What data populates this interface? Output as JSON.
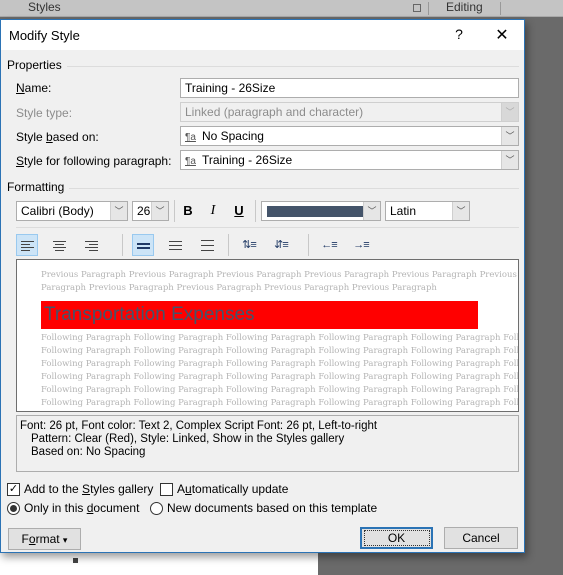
{
  "ribbon": {
    "styles_label": "Styles",
    "editing_label": "Editing"
  },
  "dialog": {
    "title": "Modify Style",
    "help_label": "?",
    "close_label": "✕"
  },
  "properties": {
    "group_label": "Properties",
    "name": {
      "label_prefix": "",
      "label_accel": "N",
      "label_rest": "ame:",
      "value": "Training - 26Size"
    },
    "style_type": {
      "label": "Style type:",
      "value": "Linked (paragraph and character)"
    },
    "based_on": {
      "label_pre": "Style ",
      "label_accel": "b",
      "label_rest": "ased on:",
      "value": "No Spacing",
      "icon": "¶a"
    },
    "following": {
      "label_accel": "S",
      "label_rest": "tyle for following paragraph:",
      "value": "Training - 26Size",
      "icon": "¶a"
    }
  },
  "formatting": {
    "group_label": "Formatting",
    "font": "Calibri (Body)",
    "size": "26",
    "bold": "B",
    "italic": "I",
    "underline": "U",
    "font_color": "#44546a",
    "script": "Latin",
    "alignment_selected": "left",
    "spacing_selected": "single"
  },
  "preview": {
    "previous_lines": [
      "Previous Paragraph Previous Paragraph Previous Paragraph Previous Paragraph Previous Paragraph Previous",
      "Paragraph Previous Paragraph Previous Paragraph Previous Paragraph Previous Paragraph"
    ],
    "sample_text": "Transportation Expenses",
    "sample_bg": "#ff0000",
    "sample_color": "#44546a",
    "following_lines": [
      "Following Paragraph Following Paragraph Following Paragraph Following Paragraph Following Paragraph Following Paragraph",
      "Following Paragraph Following Paragraph Following Paragraph Following Paragraph Following Paragraph Following Paragraph",
      "Following Paragraph Following Paragraph Following Paragraph Following Paragraph Following Paragraph Following Paragraph",
      "Following Paragraph Following Paragraph Following Paragraph Following Paragraph Following Paragraph Following Paragraph",
      "Following Paragraph Following Paragraph Following Paragraph Following Paragraph Following Paragraph Following Paragraph",
      "Following Paragraph Following Paragraph Following Paragraph Following Paragraph Following Paragraph Following Paragraph"
    ]
  },
  "description": {
    "line1": "Font: 26 pt, Font color: Text 2, Complex Script Font: 26 pt, Left-to-right",
    "line2": "Pattern: Clear (Red), Style: Linked, Show in the Styles gallery",
    "line3": "Based on: No Spacing"
  },
  "options": {
    "add_to_gallery": {
      "pre": "Add to the ",
      "accel": "S",
      "rest": "tyles gallery",
      "checked": true
    },
    "auto_update": {
      "pre": "A",
      "accel": "u",
      "rest": "tomatically update",
      "checked": false
    },
    "only_this_doc": {
      "pre": "Only in this ",
      "accel": "d",
      "rest": "ocument",
      "selected": true
    },
    "new_docs": {
      "label": "New documents based on this template",
      "selected": false
    }
  },
  "buttons": {
    "format": {
      "pre": "F",
      "accel": "o",
      "rest": "rmat",
      "arrow": "▾"
    },
    "ok": "OK",
    "cancel": "Cancel"
  }
}
